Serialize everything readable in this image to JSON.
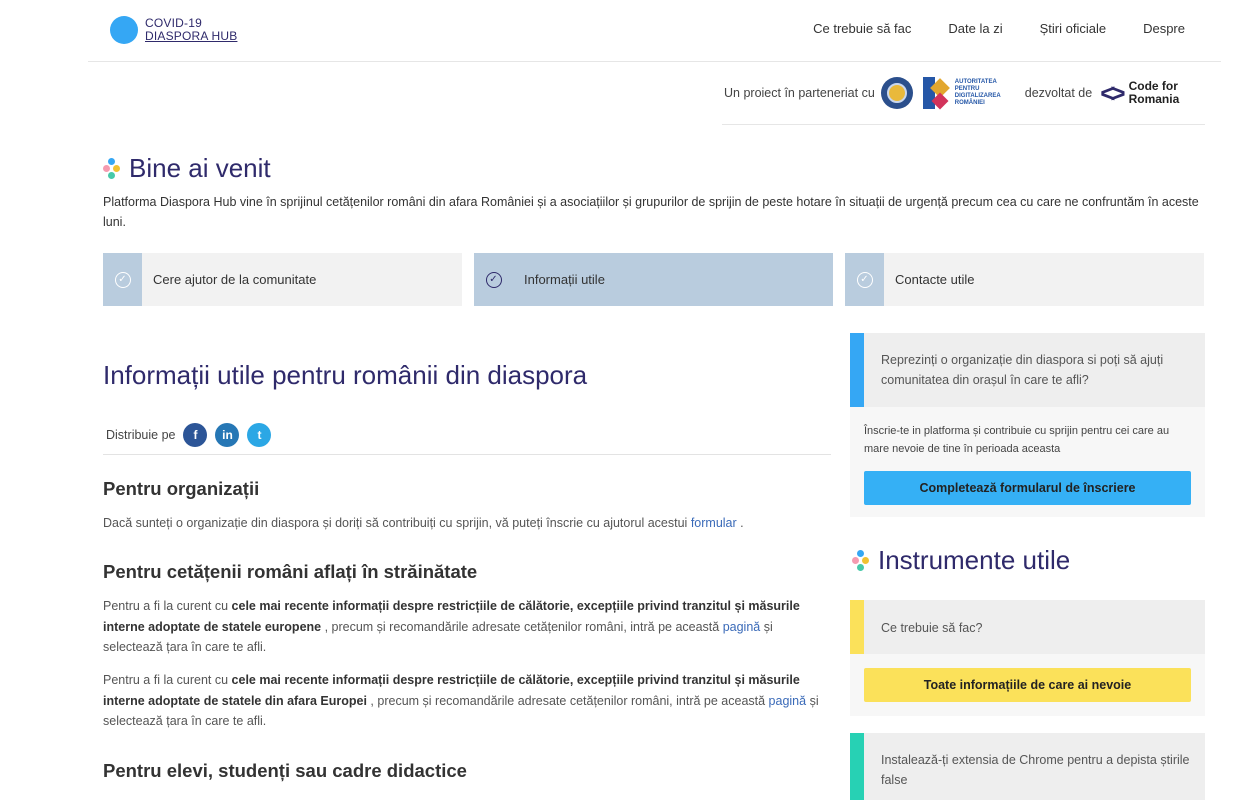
{
  "header": {
    "logo_line1": "COVID-19",
    "logo_line2": "DIASPORA HUB",
    "nav": [
      "Ce trebuie să fac",
      "Date la zi",
      "Știri oficiale",
      "Despre"
    ]
  },
  "partners": {
    "text1": "Un proiect în parteneriat cu",
    "adr_text": "AUTORITATEA PENTRU DIGITALIZAREA ROMÂNIEI",
    "text2": "dezvoltat de",
    "cfr_line1": "Code for",
    "cfr_line2": "Romania"
  },
  "welcome": {
    "title": "Bine ai venit",
    "description": "Platforma Diaspora Hub vine în sprijinul cetățenilor români din afara României și a asociațiilor și grupurilor de sprijin de peste hotare în situații de urgență precum cea cu care ne confruntăm în aceste luni."
  },
  "tabs": [
    {
      "label": "Cere ajutor de la comunitate",
      "active": false
    },
    {
      "label": "Informații utile",
      "active": true
    },
    {
      "label": "Contacte utile",
      "active": false
    }
  ],
  "main": {
    "title": "Informații utile pentru românii din diaspora",
    "share_label": "Distribuie pe",
    "sections": {
      "org": {
        "title": "Pentru organizații",
        "text_before": "Dacă sunteți o organizație din diaspora și doriți să contribuiți cu sprijin, vă puteți înscrie cu ajutorul acestui ",
        "link": "formular",
        "text_after": " ."
      },
      "citizens": {
        "title": "Pentru cetățenii români aflați în străinătate",
        "p1_a": "Pentru a fi la curent cu ",
        "p1_bold": "cele mai recente informații despre restricțiile de călătorie, excepțiile privind tranzitul și măsurile interne adoptate de statele europene",
        "p1_b": " , precum și recomandările adresate cetățenilor români, intră pe această ",
        "p1_link": "pagină",
        "p1_c": " și selectează țara în care te afli.",
        "p2_a": "Pentru a fi la curent cu ",
        "p2_bold": "cele mai recente informații despre restricțiile de călătorie, excepțiile privind tranzitul și măsurile interne adoptate de statele din afara Europei",
        "p2_b": " , precum și recomandările adresate cetățenilor români, intră pe această ",
        "p2_link": "pagină",
        "p2_c": " și selectează țara în care te afli."
      },
      "students": {
        "title": "Pentru elevi, studenți sau cadre didactice"
      }
    }
  },
  "sidebar": {
    "org_card": {
      "head": "Reprezinți o organizație din diaspora si poți să ajuți comunitatea din orașul în care te afli?",
      "sub": "Înscrie-te in platforma și contribuie cu sprijin pentru cei care au mare nevoie de tine în perioada aceasta",
      "button": "Completează formularul de înscriere"
    },
    "tools_title": "Instrumente utile",
    "tool1": {
      "head": "Ce trebuie să fac?",
      "button": "Toate informațiile de care ai nevoie"
    },
    "tool2": {
      "head": "Instalează-ți extensia de Chrome pentru a depista știrile false"
    }
  },
  "colors": {
    "primary": "#2f2a6b",
    "blue_accent": "#35a7f4",
    "yellow_accent": "#fbe15a",
    "teal_accent": "#27d1b4",
    "tab_active": "#b9ccde"
  }
}
